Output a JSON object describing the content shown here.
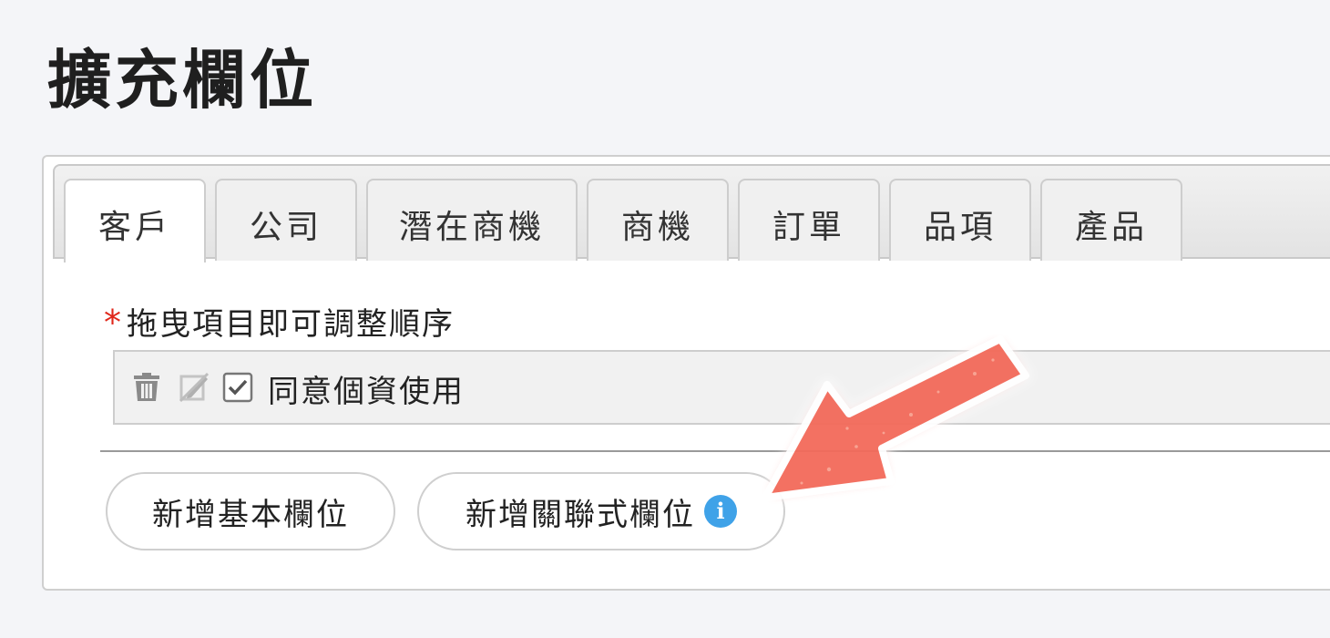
{
  "page": {
    "title": "擴充欄位"
  },
  "tabs": [
    {
      "label": "客戶",
      "active": true
    },
    {
      "label": "公司",
      "active": false
    },
    {
      "label": "潛在商機",
      "active": false
    },
    {
      "label": "商機",
      "active": false
    },
    {
      "label": "訂單",
      "active": false
    },
    {
      "label": "品項",
      "active": false
    },
    {
      "label": "產品",
      "active": false
    }
  ],
  "sort_hint": {
    "required_mark": "*",
    "text": "拖曳項目即可調整順序"
  },
  "field_item": {
    "label": "同意個資使用",
    "icons": [
      "trash-icon",
      "edit-disabled-icon",
      "checkbox-icon"
    ],
    "checked": true
  },
  "buttons": {
    "add_basic": "新增基本欄位",
    "add_relational": "新增關聯式欄位"
  },
  "colors": {
    "required_star": "#e0271a",
    "info_icon": "#3fa2e8",
    "annotation_arrow": "#f36b5a"
  }
}
